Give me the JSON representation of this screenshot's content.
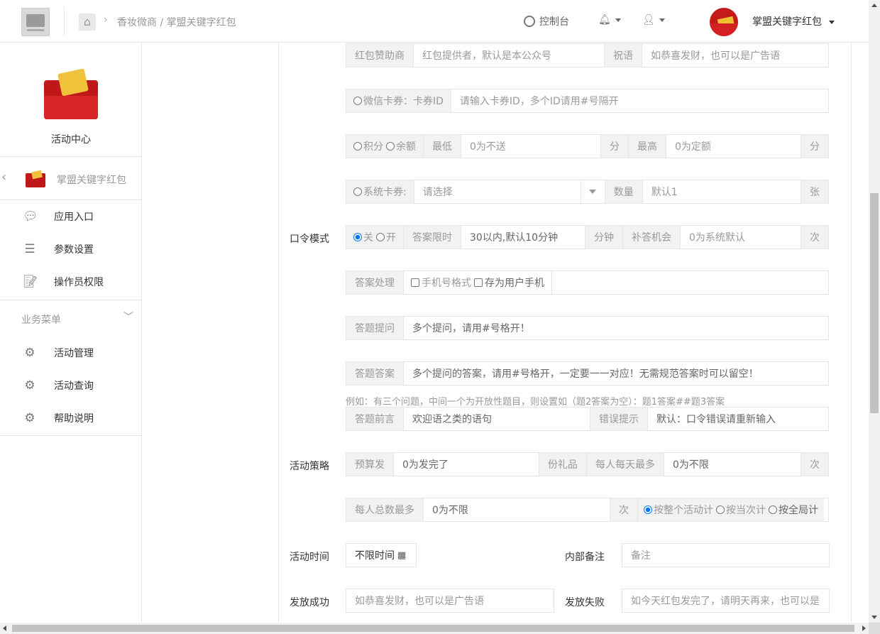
{
  "header": {
    "breadcrumb": "香妆微商 / 掌盟关键字红包",
    "console": "控制台",
    "account_name": "掌盟关键字红包"
  },
  "sidebar": {
    "title": "活动中心",
    "app_name": "掌盟关键字红包",
    "items": [
      {
        "label": "应用入口",
        "icon": "chat-icon"
      },
      {
        "label": "参数设置",
        "icon": "list-icon"
      },
      {
        "label": "操作员权限",
        "icon": "doc-edit-icon"
      }
    ],
    "section": "业务菜单",
    "business_items": [
      {
        "label": "活动管理",
        "icon": "gear-icon"
      },
      {
        "label": "活动查询",
        "icon": "gear-icon"
      },
      {
        "label": "帮助说明",
        "icon": "gear-icon"
      }
    ]
  },
  "form": {
    "sponsor": {
      "label": "红包赞助商",
      "placeholder": "红包提供者，默认是本公众号",
      "blessing_label": "祝语",
      "blessing_placeholder": "如恭喜发财，也可以是广告语"
    },
    "wx_card": {
      "option": "微信卡券：",
      "addon": "卡券ID",
      "placeholder": "请输入卡券ID，多个ID请用#号隔开"
    },
    "points": {
      "opt1": "积分",
      "opt2": "余额",
      "min_label": "最低",
      "min_placeholder": "0为不送",
      "unit": "分",
      "max_label": "最高",
      "max_placeholder": "0为定额",
      "unit2": "分"
    },
    "sys_card": {
      "option": "系统卡券:",
      "select": "请选择",
      "qty_label": "数量",
      "qty_placeholder": "默认1",
      "unit": "张"
    },
    "password": {
      "label": "口令模式",
      "off": "关",
      "on": "开",
      "limit_label": "答案限时",
      "limit_value": "30以内,默认10分钟",
      "minute": "分钟",
      "retry_label": "补答机会",
      "retry_placeholder": "0为系统默认",
      "times": "次"
    },
    "answer_process": {
      "label": "答案处理",
      "opt1": "手机号格式",
      "opt2": "存为用户手机"
    },
    "question": {
      "label": "答题提问",
      "placeholder": "多个提问，请用#号格开！"
    },
    "answer": {
      "label": "答题答案",
      "placeholder": "多个提问的答案，请用#号格开，一定要一一对应！无需规范答案时可以留空！"
    },
    "hint": "例如：有三个问题，中间一个为开放性题目，则设置如（题2答案为空）：题1答案##题3答案",
    "preface": {
      "label": "答题前言",
      "placeholder": "欢迎语之类的语句",
      "error_label": "错误提示",
      "error_placeholder": "默认：口令错误请重新输入"
    },
    "strategy": {
      "label": "活动策略",
      "budget_label": "预算发",
      "budget_placeholder": "0为发完了",
      "gift_label": "份礼品",
      "daily_label": "每人每天最多",
      "daily_placeholder": "0为不限",
      "times": "次"
    },
    "total": {
      "label": "每人总数最多",
      "placeholder": "0为不限",
      "times": "次",
      "opt1": "按整个活动计",
      "opt2": "按当次计",
      "opt3": "按全局计"
    },
    "time": {
      "label": "活动时间",
      "value": "不限时间",
      "remark_label": "内部备注",
      "remark_placeholder": "备注"
    },
    "result": {
      "success_label": "发放成功",
      "success_placeholder": "如恭喜发财，也可以是广告语",
      "fail_label": "发放失败",
      "fail_placeholder": "如今天红包发完了，请明天再来，也可以是"
    }
  }
}
